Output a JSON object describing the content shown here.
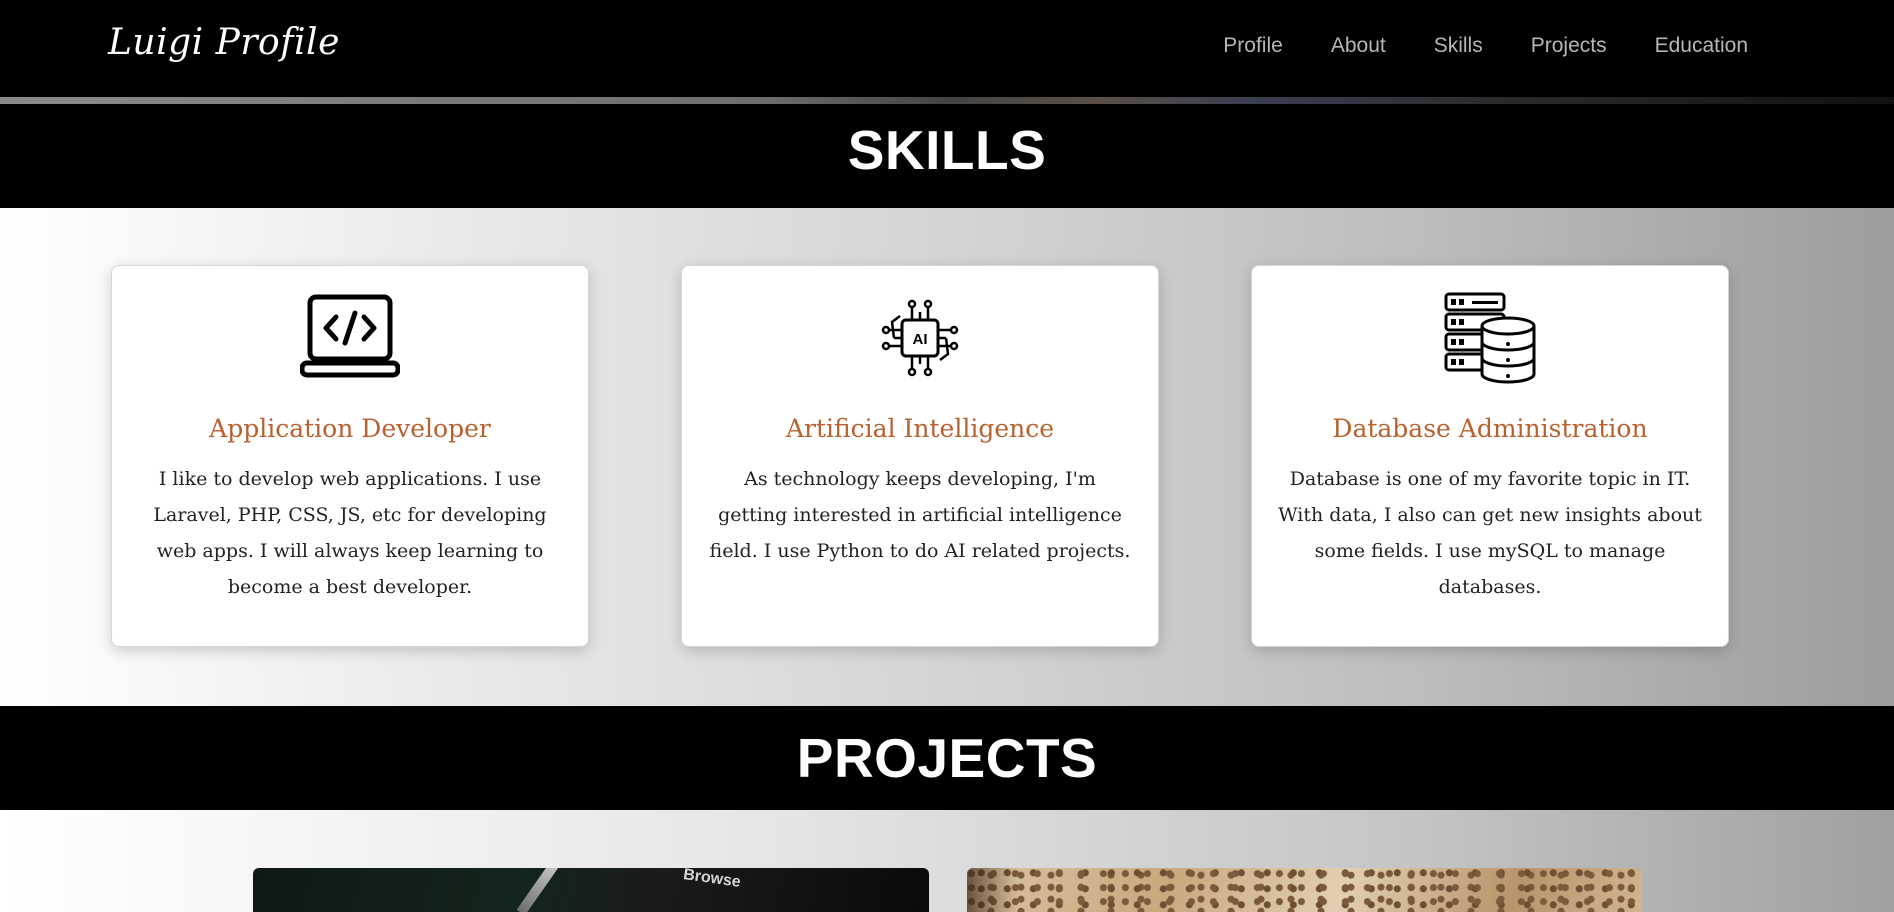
{
  "navbar": {
    "brand": "Luigi Profile",
    "links": [
      {
        "label": "Profile"
      },
      {
        "label": "About"
      },
      {
        "label": "Skills"
      },
      {
        "label": "Projects"
      },
      {
        "label": "Education"
      }
    ]
  },
  "skills": {
    "heading": "SKILLS",
    "cards": [
      {
        "icon": "laptop-code-icon",
        "title": "Application Developer",
        "text": "I like to develop web applications. I use Laravel, PHP, CSS, JS, etc for developing web apps. I will always keep learning to become a best developer."
      },
      {
        "icon": "ai-chip-icon",
        "title": "Artificial Intelligence",
        "text": "As technology keeps developing, I'm getting interested in artificial intelligence field. I use Python to do AI related projects."
      },
      {
        "icon": "database-server-icon",
        "title": "Database Administration",
        "text": "Database is one of my favorite topic in IT. With data, I also can get new insights about some fields. I use mySQL to manage databases."
      }
    ]
  },
  "projects": {
    "heading": "PROJECTS",
    "thumb_text": "Browse"
  },
  "colors": {
    "accent": "#b8612e",
    "header_bg": "#000000",
    "nav_link": "#b6b6b6"
  }
}
